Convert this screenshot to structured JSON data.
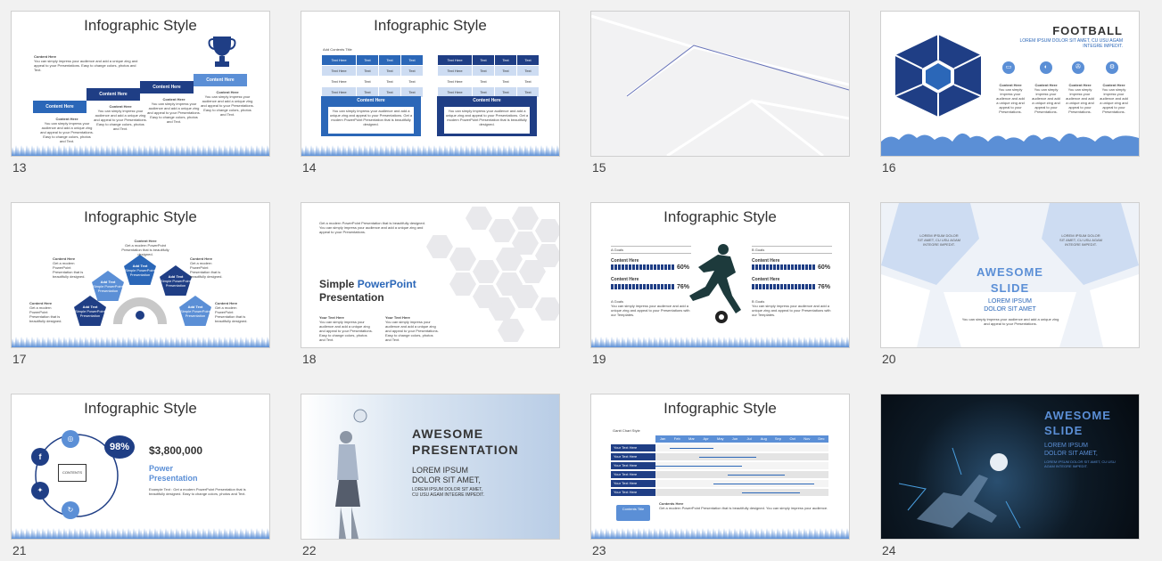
{
  "slides": [
    {
      "num": "13",
      "title": "Infographic Style",
      "steps": [
        "Content Here",
        "Content Here",
        "Content Here",
        "Content Here"
      ],
      "captions": [
        "Content Here",
        "Content Here",
        "Content Here",
        "Content Here"
      ],
      "body": "You can simply impress your audience and add a unique zing and appeal to your Presentations. Easy to change colors, photos and Text."
    },
    {
      "num": "14",
      "title": "Infographic Style",
      "subtitle": "Add Contents Title",
      "col_header": "Text Here",
      "col_text": "Text",
      "box_title": "Content Here",
      "box_text": "You can simply impress your audience and add a unique zing and appeal to your Presentations. Get a modern PowerPoint Presentation that is beautifully designed."
    },
    {
      "num": "15"
    },
    {
      "num": "16",
      "title": "FOOTBALL",
      "subtitle": "LOREM IPSUM DOLOR SIT AMET, CU USU AGAM INTEGRE IMPEDIT.",
      "hex_label": "Text Here",
      "item_label": "Content Here",
      "item_text": "You can simply impress your audience and add a unique zing and appeal to your Presentations."
    },
    {
      "num": "17",
      "title": "Infographic Style",
      "pent_title": "Add Text",
      "pent_text": "Simple PowerPoint Presentation",
      "label": "Content Here",
      "text": "Get a modern PowerPoint Presentation that is beautifully designed."
    },
    {
      "num": "18",
      "heading_a": "Simple ",
      "heading_b": "PowerPoint",
      "heading_c": "Presentation",
      "intro": "Get a modern PowerPoint Presentation that is beautifully designed. You can simply impress your audience and add a unique zing and appeal to your Presentations.",
      "label": "Your Text Here",
      "text": "You can simply impress your audience and add a unique zing and appeal to your Presentations. Easy to change colors, photos and Text."
    },
    {
      "num": "19",
      "title": "Infographic Style",
      "group_a": "A Goals",
      "group_b": "B Goals",
      "row_label": "Content Here",
      "pct1": "60%",
      "pct2": "76%",
      "text": "You can simply impress your audience and add a unique zing and appeal to your Presentations with our Templates."
    },
    {
      "num": "20",
      "title_line1": "AWESOME",
      "title_line2": "SLIDE",
      "sub1": "LOREM IPSUM",
      "sub2": "DOLOR SIT AMET",
      "corner_text": "LOREM IPSUM DOLOR SIT AMET, CU USU AGAM INTEGRE IMPEDIT.",
      "body": "You can simply impress your audience and add a unique zing and appeal to your Presentations."
    },
    {
      "num": "21",
      "title": "Infographic Style",
      "pct": "98%",
      "money": "$3,800,000",
      "power1": "Power",
      "power2": "Presentation",
      "contents": "CONTENTS",
      "text": "Example Text : Get a modern PowerPoint Presentation that is beautifully designed. Easy to change colors, photos and Text."
    },
    {
      "num": "22",
      "line1": "AWESOME",
      "line2": "PRESENTATION",
      "sub1": "LOREM IPSUM",
      "sub2": "DOLOR SIT AMET,",
      "small1": "LOREM IPSUM DOLOR SIT AMET,",
      "small2": "CU USU AGAM INTEGRE IMPEDIT."
    },
    {
      "num": "23",
      "title": "Infographic Style",
      "chart_title": "Gantt Chart Style",
      "months": [
        "Jan",
        "Feb",
        "Mar",
        "Apr",
        "May",
        "Jun",
        "Jul",
        "Aug",
        "Sep",
        "Oct",
        "Nov",
        "Dec"
      ],
      "row_label": "Your Text Here",
      "contents_label": "Contents Title",
      "contents_head": "Contents Here",
      "text": "Get a modern PowerPoint Presentation that is beautifully designed. You can simply impress your audience."
    },
    {
      "num": "24",
      "line1": "AWESOME",
      "line2": "SLIDE",
      "sub1": "LOREM IPSUM",
      "sub2": "DOLOR SIT AMET,",
      "small": "LOREM IPSUM DOLOR SIT AMET, CU USU AGAM INTEGRE IMPEDIT."
    }
  ],
  "colors": {
    "dark": "#1f3e85",
    "mid": "#2b67b8",
    "light": "#5b8fd6",
    "pale": "#cddcf2"
  }
}
